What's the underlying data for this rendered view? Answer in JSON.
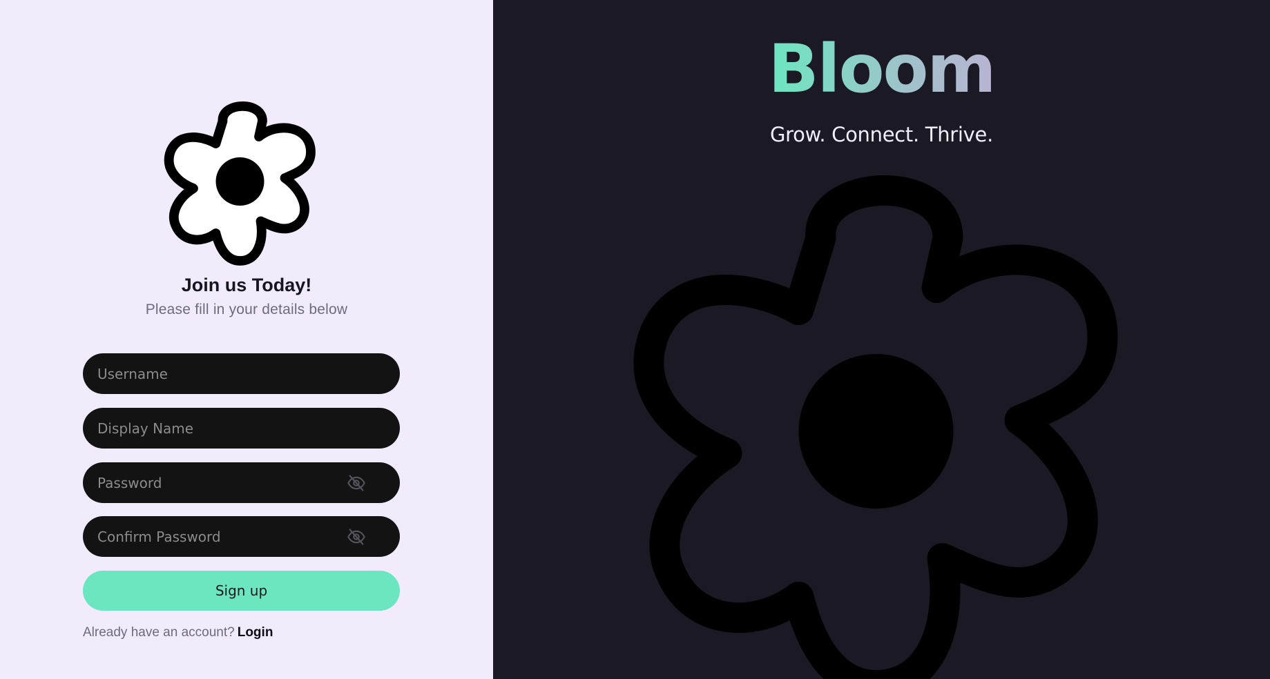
{
  "signup_form": {
    "logo_icon": "flower-icon",
    "heading": "Join us Today!",
    "subheading": "Please fill in your details below",
    "fields": {
      "username": {
        "placeholder": "Username",
        "value": ""
      },
      "display_name": {
        "placeholder": "Display Name",
        "value": ""
      },
      "password": {
        "placeholder": "Password",
        "value": "",
        "toggle_icon": "eye-off-icon"
      },
      "confirm_password": {
        "placeholder": "Confirm Password",
        "value": "",
        "toggle_icon": "eye-off-icon"
      }
    },
    "submit_label": "Sign up",
    "login_prompt": "Already have an account?",
    "login_link": "Login"
  },
  "hero": {
    "brand": "Bloom",
    "tagline": "Grow. Connect. Thrive.",
    "illustration_icon": "flower-icon"
  },
  "colors": {
    "left_background": "#f1ebfc",
    "right_background": "#1b1a24",
    "field_background": "#131313",
    "accent": "#6ce6c0",
    "brand_gradient": [
      "#6ce6c0",
      "#b9b4d2"
    ]
  }
}
